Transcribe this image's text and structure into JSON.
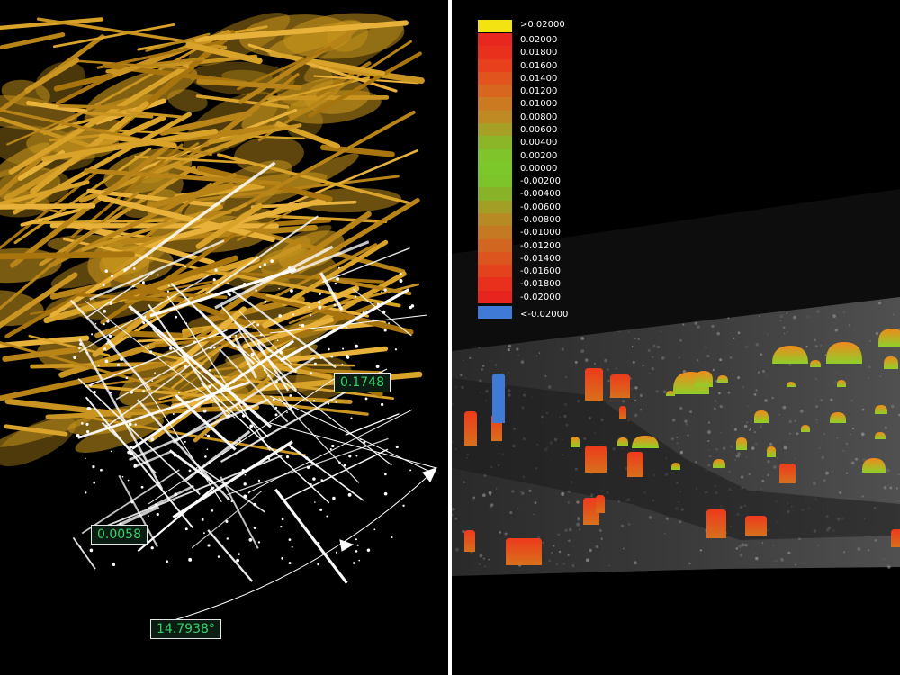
{
  "left_panel": {
    "description_icon": "fiber-volume-icon",
    "measurements": {
      "thickness": "0.1748",
      "small": "0.0058",
      "angle": "14.7938°"
    },
    "colors": {
      "fiber": "#c9961c",
      "highlight": "#ffffff",
      "label_text": "#37d06a"
    }
  },
  "right_panel": {
    "legend": {
      "over_label": ">0.02000",
      "under_label": "<-0.02000",
      "over_color": "#f3e312",
      "under_color": "#3f7bd6",
      "steps": [
        {
          "label": "0.02000",
          "color": "#e8271e"
        },
        {
          "label": "0.01800",
          "color": "#e8301d"
        },
        {
          "label": "0.01600",
          "color": "#e8401d"
        },
        {
          "label": "0.01400",
          "color": "#e2541d"
        },
        {
          "label": "0.01200",
          "color": "#d8661f"
        },
        {
          "label": "0.01000",
          "color": "#cc7a22"
        },
        {
          "label": "0.00800",
          "color": "#bf8a24"
        },
        {
          "label": "0.00600",
          "color": "#a7a027"
        },
        {
          "label": "0.00400",
          "color": "#8ab628"
        },
        {
          "label": "0.00200",
          "color": "#7ec42a"
        },
        {
          "label": "0.00000",
          "color": "#7cc82a"
        },
        {
          "label": "-0.00200",
          "color": "#7cc42a"
        },
        {
          "label": "-0.00400",
          "color": "#88b328"
        },
        {
          "label": "-0.00600",
          "color": "#a39f26"
        },
        {
          "label": "-0.00800",
          "color": "#b88a24"
        },
        {
          "label": "-0.01000",
          "color": "#c47922"
        },
        {
          "label": "-0.01200",
          "color": "#d06620"
        },
        {
          "label": "-0.01400",
          "color": "#dc541e"
        },
        {
          "label": "-0.01600",
          "color": "#e4421d"
        },
        {
          "label": "-0.01800",
          "color": "#e8301d"
        },
        {
          "label": "-0.02000",
          "color": "#e8241e"
        }
      ]
    }
  }
}
